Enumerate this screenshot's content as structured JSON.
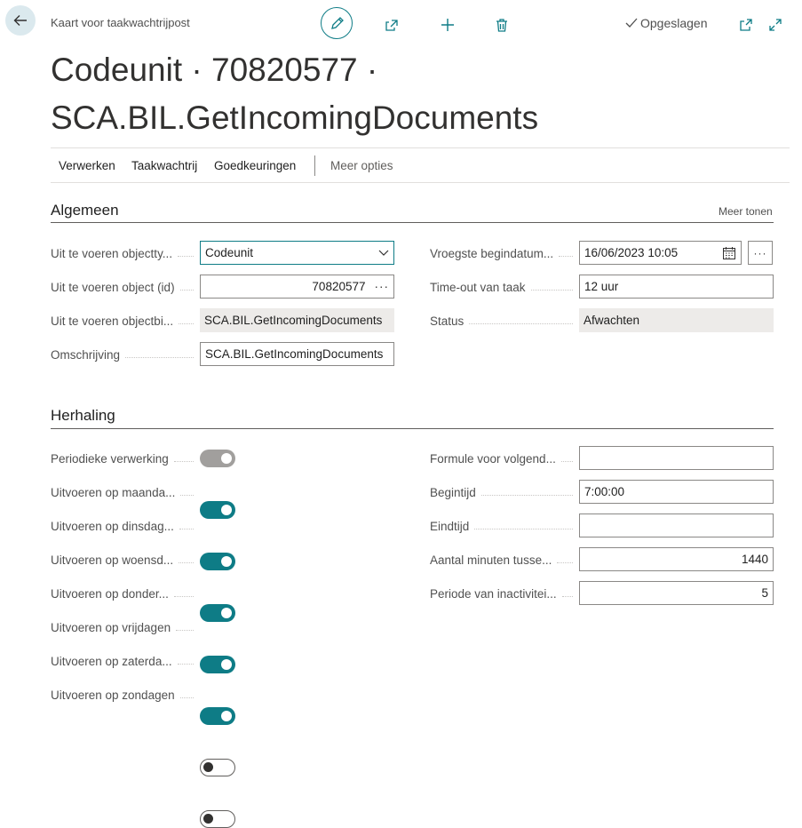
{
  "header": {
    "breadcrumb": "Kaart voor taakwachtrijpost",
    "saved_label": "Opgeslagen",
    "title_line1": "Codeunit · 70820577 ·",
    "title_line2": "SCA.BIL.GetIncomingDocuments"
  },
  "actions": {
    "process": "Verwerken",
    "queue": "Taakwachtrij",
    "approvals": "Goedkeuringen",
    "more": "Meer opties"
  },
  "general": {
    "title": "Algemeen",
    "show_more": "Meer tonen",
    "object_type_label": "Uit te voeren objectty...",
    "object_type_value": "Codeunit",
    "object_id_label": "Uit te voeren object (id)",
    "object_id_value": "70820577",
    "object_caption_label": "Uit te voeren objectbi...",
    "object_caption_value": "SCA.BIL.GetIncomingDocuments",
    "description_label": "Omschrijving",
    "description_value": "SCA.BIL.GetIncomingDocuments",
    "earliest_start_label": "Vroegste begindatum...",
    "earliest_start_value": "16/06/2023 10:05",
    "timeout_label": "Time-out van taak",
    "timeout_value": "12 uur",
    "status_label": "Status",
    "status_value": "Afwachten"
  },
  "recurrence": {
    "title": "Herhaling",
    "toggles": [
      {
        "label": "Periodieke verwerking",
        "state": "disabled-on"
      },
      {
        "label": "Uitvoeren op maanda...",
        "state": "on"
      },
      {
        "label": "Uitvoeren op dinsdag...",
        "state": "on"
      },
      {
        "label": "Uitvoeren op woensd...",
        "state": "on"
      },
      {
        "label": "Uitvoeren op donder...",
        "state": "on"
      },
      {
        "label": "Uitvoeren op vrijdagen",
        "state": "on"
      },
      {
        "label": "Uitvoeren op zaterda...",
        "state": "off"
      },
      {
        "label": "Uitvoeren op zondagen",
        "state": "off"
      }
    ],
    "formula_label": "Formule voor volgend...",
    "formula_value": "",
    "start_time_label": "Begintijd",
    "start_time_value": "7:00:00",
    "end_time_label": "Eindtijd",
    "end_time_value": "",
    "minutes_label": "Aantal minuten tusse...",
    "minutes_value": "1440",
    "inactivity_label": "Periode van inactivitei...",
    "inactivity_value": "5"
  },
  "colors": {
    "accent": "#0e7c86",
    "readonly_bg": "#edebe9"
  },
  "icons": {
    "back": "arrow-left-icon",
    "edit": "pencil-icon",
    "share": "share-icon",
    "add": "plus-icon",
    "delete": "trash-icon",
    "saved": "checkmark-icon",
    "open_new": "open-in-new-window-icon",
    "expand": "expand-icon",
    "dropdown": "chevron-down-icon",
    "calendar": "calendar-icon",
    "ellipsis": "ellipsis-icon"
  }
}
